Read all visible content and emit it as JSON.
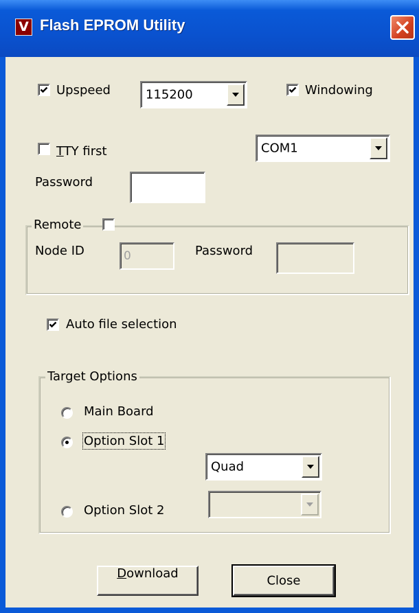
{
  "window": {
    "title": "Flash EPROM Utility",
    "icon_letter": "V",
    "title_gradient": "#0a5ad8",
    "close_color": "#d2401f"
  },
  "upspeed": {
    "label": "Upspeed",
    "checked": true,
    "baud": "115200"
  },
  "windowing": {
    "label": "Windowing",
    "checked": true
  },
  "tty_first": {
    "label_underlined": "T",
    "label_rest": "TY first",
    "checked": false
  },
  "port": {
    "value": "COM1"
  },
  "password": {
    "label": "Password",
    "value": ""
  },
  "remote": {
    "label": "Remote",
    "checked": false,
    "node_id_label": "Node ID",
    "node_id_value": "0",
    "password_label": "Password",
    "password_value": ""
  },
  "auto_file": {
    "label": "Auto file selection",
    "checked": true
  },
  "target_options": {
    "title": "Target Options",
    "main_board": {
      "label": "Main Board",
      "selected": false
    },
    "slot1": {
      "label": "Option Slot 1",
      "selected": true,
      "combo_value": "Quad"
    },
    "slot2": {
      "label": "Option Slot 2",
      "selected": false,
      "combo_value": ""
    }
  },
  "buttons": {
    "download_underlined": "D",
    "download_rest": "ownload",
    "close": "Close"
  }
}
